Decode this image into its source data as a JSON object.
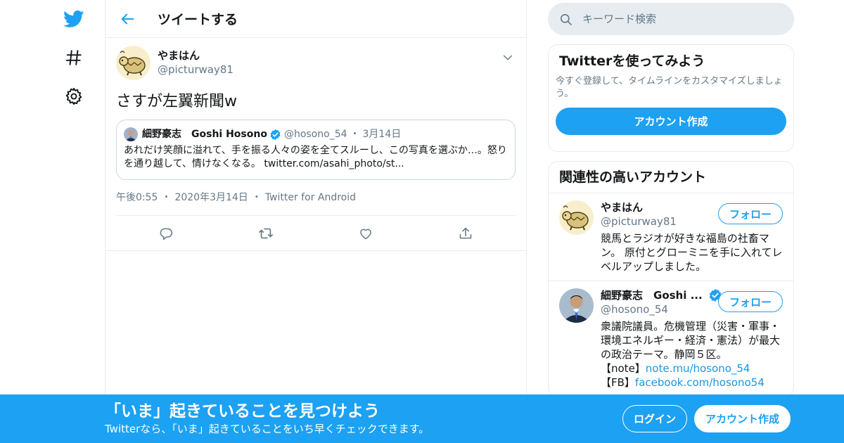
{
  "colors": {
    "accent": "#1da1f2",
    "secondary_text": "#657786",
    "border": "#e6ecf0",
    "link": "#1b95e0"
  },
  "nav": {
    "items": [
      {
        "icon": "twitter-bird-icon"
      },
      {
        "icon": "hashtag-icon"
      },
      {
        "icon": "gear-icon"
      }
    ]
  },
  "header": {
    "title": "ツイートする",
    "back_icon": "arrow-left-icon"
  },
  "tweet": {
    "display_name": "やまはん",
    "handle": "@picturway81",
    "text": "さすが左翼新聞w",
    "quote": {
      "name": "細野豪志　Goshi Hosono",
      "handle": "@hosono_54",
      "separator": "・",
      "date": "3月14日",
      "body": "あれだけ笑顔に溢れて、手を振る人々の姿を全てスルーし、この写真を選ぶか…。怒りを通り越して、情けなくなる。 twitter.com/asahi_photo/st..."
    },
    "time": "午後0:55",
    "date": "2020年3月14日",
    "source": "Twitter for Android",
    "separator": "・",
    "actions": [
      "reply-icon",
      "retweet-icon",
      "like-icon",
      "share-icon"
    ]
  },
  "search": {
    "placeholder": "キーワード検索"
  },
  "signup_card": {
    "title": "Twitterを使ってみよう",
    "description": "今すぐ登録して、タイムラインをカスタマイズしましょう。",
    "button": "アカウント作成"
  },
  "related": {
    "title": "関連性の高いアカウント",
    "users": [
      {
        "name": "やまはん",
        "handle": "@picturway81",
        "bio": "競馬とラジオが好きな福島の社畜マン。 原付とグローミニを手に入れてレベルアップしました。",
        "follow": "フォロー"
      },
      {
        "name": "細野豪志　Goshi ...",
        "handle": "@hosono_54",
        "bio": "衆議院議員。危機管理（災害・軍事・環境エネルギー・経済・憲法）が最大の政治テーマ。静岡５区。",
        "note_label": "【note】",
        "note_link": "note.mu/hosono_54",
        "fb_label": "【FB】",
        "fb_link": "facebook.com/hosono54",
        "follow": "フォロー"
      }
    ]
  },
  "bottom_bar": {
    "title": "「いま」起きていることを見つけよう",
    "subtitle": "Twitterなら、「いま」起きていることをいち早くチェックできます。",
    "login": "ログイン",
    "create": "アカウント作成"
  }
}
